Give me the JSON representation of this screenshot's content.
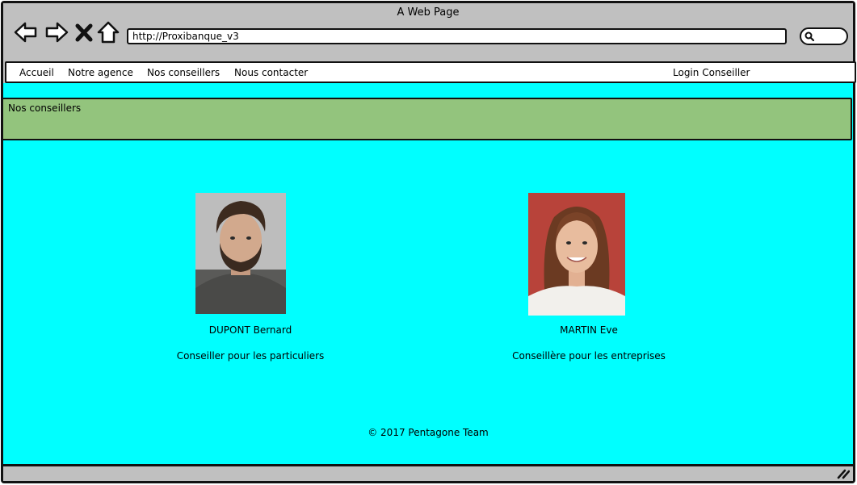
{
  "window": {
    "title": "A Web Page"
  },
  "browser": {
    "url": "http://Proxibanque_v3",
    "icons": [
      "back-arrow-icon",
      "forward-arrow-icon",
      "close-x-icon",
      "home-icon",
      "search-icon",
      "resize-grip-icon"
    ]
  },
  "navbar": {
    "items": [
      {
        "label": "Accueil"
      },
      {
        "label": "Notre agence"
      },
      {
        "label": "Nos conseillers"
      },
      {
        "label": "Nous contacter"
      }
    ],
    "login_label": "Login Conseiller"
  },
  "page": {
    "heading": "Nos conseillers"
  },
  "advisors": [
    {
      "name": "DUPONT Bernard",
      "role": "Conseiller pour les particuliers"
    },
    {
      "name": "MARTIN Eve",
      "role": "Conseillère pour les entreprises"
    }
  ],
  "footer": {
    "text": "© 2017 Pentagone Team"
  },
  "colors": {
    "content_bg": "#00ffff",
    "heading_bg": "#93c47d",
    "chrome_bg": "#c0c0c0"
  }
}
